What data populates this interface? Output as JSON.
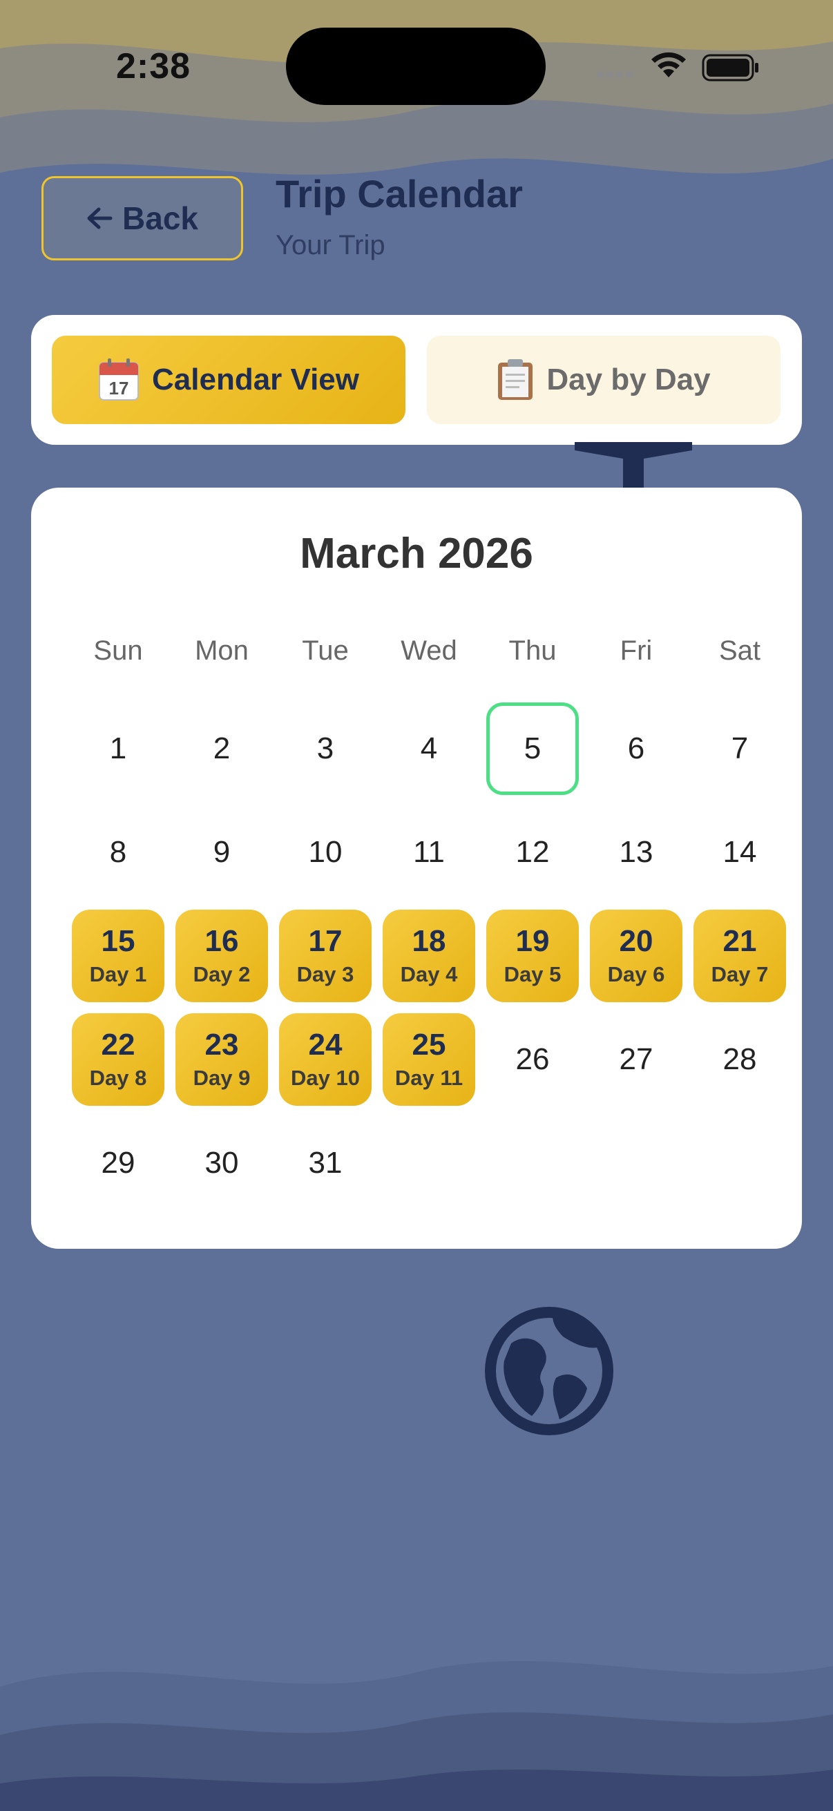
{
  "status": {
    "time": "2:38"
  },
  "header": {
    "back_label": "Back",
    "title": "Trip Calendar",
    "subtitle": "Your Trip"
  },
  "toggle": {
    "calendar_label": "Calendar View",
    "day_label": "Day by Day"
  },
  "calendar": {
    "month_label": "March 2026",
    "weekdays": [
      "Sun",
      "Mon",
      "Tue",
      "Wed",
      "Thu",
      "Fri",
      "Sat"
    ],
    "today": 5,
    "first_weekday_index": 0,
    "days_in_month": 31,
    "trip_days": [
      {
        "date": 15,
        "label": "Day 1"
      },
      {
        "date": 16,
        "label": "Day 2"
      },
      {
        "date": 17,
        "label": "Day 3"
      },
      {
        "date": 18,
        "label": "Day 4"
      },
      {
        "date": 19,
        "label": "Day 5"
      },
      {
        "date": 20,
        "label": "Day 6"
      },
      {
        "date": 21,
        "label": "Day 7"
      },
      {
        "date": 22,
        "label": "Day 8"
      },
      {
        "date": 23,
        "label": "Day 9"
      },
      {
        "date": 24,
        "label": "Day 10"
      },
      {
        "date": 25,
        "label": "Day 11"
      }
    ]
  },
  "icons": {
    "back": "arrow-left-icon",
    "calendar": "calendar-icon",
    "clipboard": "clipboard-icon",
    "globe": "globe-icon",
    "plane": "airplane-icon",
    "wifi": "wifi-icon",
    "battery": "battery-icon"
  },
  "colors": {
    "accent": "#f0c52c",
    "today_border": "#4ede86",
    "background": "#5e6f98",
    "text_dark": "#1f2d52"
  }
}
